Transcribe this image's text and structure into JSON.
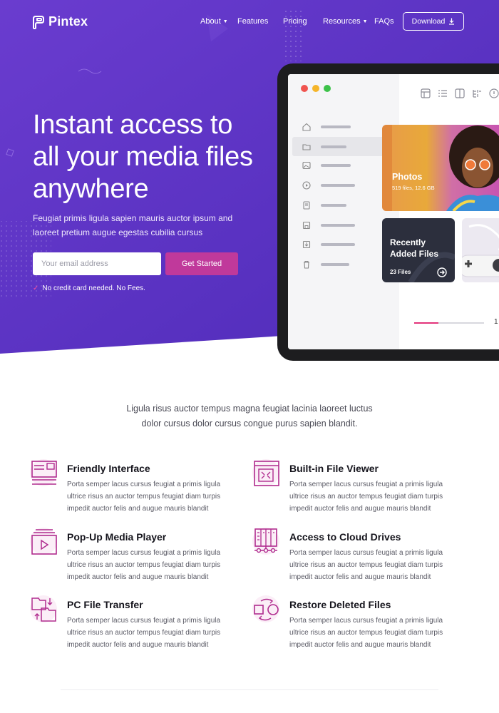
{
  "brand": {
    "name": "Pintex"
  },
  "nav": {
    "links": [
      {
        "label": "About",
        "has_caret": true
      },
      {
        "label": "Features",
        "has_caret": false
      },
      {
        "label": "Pricing",
        "has_caret": false
      },
      {
        "label": "Resources",
        "has_caret": true
      },
      {
        "label": "FAQs",
        "has_caret": false
      }
    ],
    "download_label": "Download"
  },
  "hero": {
    "title": "Instant access to all your media files anywhere",
    "subtitle": "Feugiat primis ligula sapien mauris auctor ipsum and laoreet pretium augue egestas cubilia cursus",
    "email_placeholder": "Your email address",
    "cta_label": "Get Started",
    "note": "No credit card needed. No Fees."
  },
  "app_preview": {
    "photos_card": {
      "title": "Photos",
      "meta": "519 files, 12.6 GB"
    },
    "recent_card": {
      "title_line1": "Recently",
      "title_line2": "Added Files",
      "meta": "23 Files"
    },
    "progress_fraction": 0.35,
    "page_number": "1"
  },
  "intro": {
    "line1": "Ligula risus auctor tempus magna feugiat lacinia laoreet luctus",
    "line2": "dolor cursus dolor cursus congue purus sapien blandit."
  },
  "features": [
    {
      "title": "Friendly Interface",
      "desc": "Porta semper lacus cursus feugiat a primis ligula ultrice risus an auctor tempus feugiat diam turpis impedit auctor felis and augue mauris blandit",
      "icon": "interface-icon"
    },
    {
      "title": "Built-in File Viewer",
      "desc": "Porta semper lacus cursus feugiat a primis ligula ultrice risus an auctor tempus feugiat diam turpis impedit auctor felis and augue mauris blandit",
      "icon": "file-viewer-icon"
    },
    {
      "title": "Pop-Up Media Player",
      "desc": "Porta semper lacus cursus feugiat a primis ligula ultrice risus an auctor tempus feugiat diam turpis impedit auctor felis and augue mauris blandit",
      "icon": "media-player-icon"
    },
    {
      "title": "Access to Cloud Drives",
      "desc": "Porta semper lacus cursus feugiat a primis ligula ultrice risus an auctor tempus feugiat diam turpis impedit auctor felis and augue mauris blandit",
      "icon": "cloud-drives-icon"
    },
    {
      "title": "PC File Transfer",
      "desc": "Porta semper lacus cursus feugiat a primis ligula ultrice risus an auctor tempus feugiat diam turpis impedit auctor felis and augue mauris blandit",
      "icon": "file-transfer-icon"
    },
    {
      "title": "Restore Deleted Files",
      "desc": "Porta semper lacus cursus feugiat a primis ligula ultrice risus an auctor tempus feugiat diam turpis impedit auctor felis and augue mauris blandit",
      "icon": "restore-files-icon"
    }
  ],
  "colors": {
    "hero_purple": "#5a34c4",
    "accent_pink": "#c0399b",
    "icon_magenta": "#b02b8e"
  }
}
